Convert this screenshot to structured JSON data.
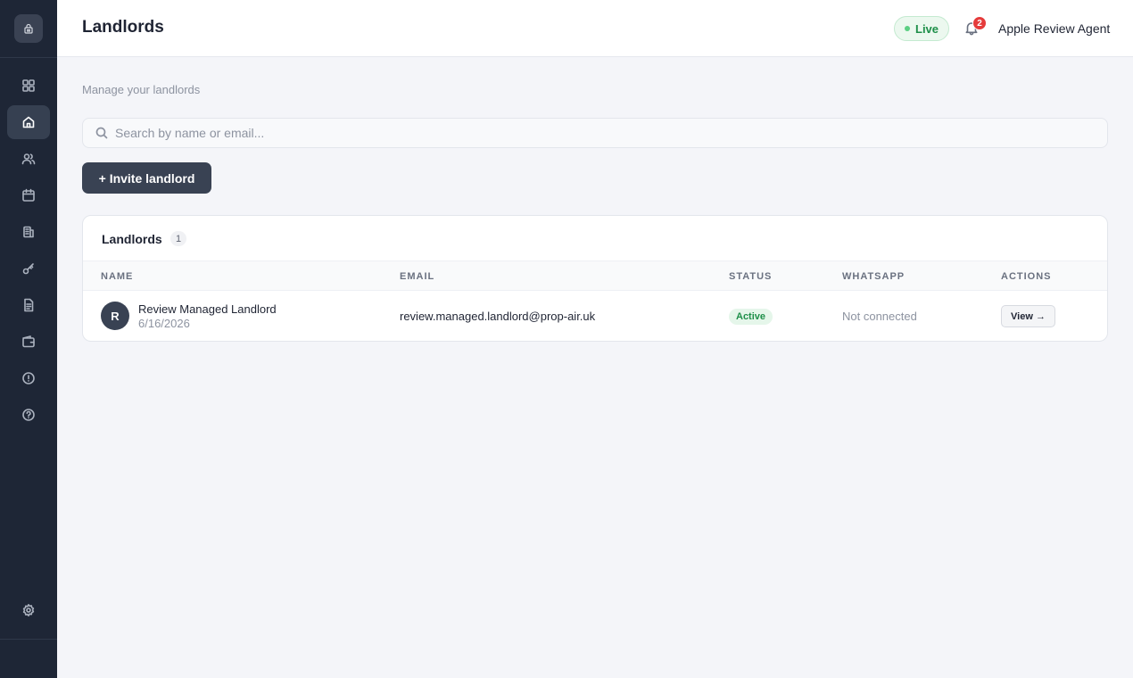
{
  "sidebar": {
    "logo_icon": "building-lock-icon",
    "items": [
      {
        "icon": "dashboard-icon",
        "active": false
      },
      {
        "icon": "home-icon",
        "active": true
      },
      {
        "icon": "users-icon",
        "active": false
      },
      {
        "icon": "calendar-icon",
        "active": false
      },
      {
        "icon": "buildings-icon",
        "active": false
      },
      {
        "icon": "key-icon",
        "active": false
      },
      {
        "icon": "document-icon",
        "active": false
      },
      {
        "icon": "wallet-icon",
        "active": false
      },
      {
        "icon": "alert-icon",
        "active": false
      },
      {
        "icon": "help-icon",
        "active": false
      }
    ],
    "settings_icon": "gear-icon"
  },
  "header": {
    "title": "Landlords",
    "live_label": "Live",
    "notification_count": "2",
    "user_name": "Apple Review Agent"
  },
  "main": {
    "subtitle": "Manage your landlords",
    "search_placeholder": "Search by name or email...",
    "invite_label": "+ Invite landlord"
  },
  "table": {
    "title": "Landlords",
    "count": "1",
    "columns": {
      "name": "NAME",
      "email": "EMAIL",
      "status": "STATUS",
      "whatsapp": "WHATSAPP",
      "actions": "ACTIONS"
    },
    "rows": [
      {
        "initial": "R",
        "name": "Review Managed Landlord",
        "date": "6/16/2026",
        "email": "review.managed.landlord@prop-air.uk",
        "status": "Active",
        "whatsapp": "Not connected",
        "action": "View →"
      }
    ]
  },
  "colors": {
    "sidebar_bg": "#1e2636",
    "accent": "#394253",
    "live_green": "#1e8f49",
    "notification_red": "#e53b3b"
  }
}
